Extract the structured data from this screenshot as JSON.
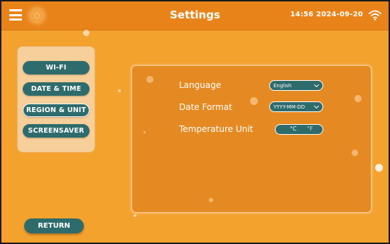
{
  "header": {
    "title": "Settings",
    "time": "14:56",
    "date": "2024-09-20",
    "left_icons": [
      "menu-icon",
      "sun-icon"
    ],
    "right_icon": "wifi-icon"
  },
  "sidebar": {
    "items": [
      {
        "label": "WI-FI",
        "active": false
      },
      {
        "label": "DATE & TIME",
        "active": false
      },
      {
        "label": "REGION & UNIT",
        "active": true
      },
      {
        "label": "SCREENSAVER",
        "active": false
      }
    ]
  },
  "settings": {
    "language": {
      "label": "Language",
      "value": "English"
    },
    "date_format": {
      "label": "Date Format",
      "value": "YYYY-MM-DD"
    },
    "temperature_unit": {
      "label": "Temperature Unit",
      "options": [
        "°C",
        "°F"
      ],
      "selected": "°C"
    }
  },
  "footer": {
    "return_label": "RETURN"
  },
  "colors": {
    "background": "#f4a22e",
    "topbar": "#e8831a",
    "panel": "#e58a22",
    "sidebar_panel": "#f7cf9a",
    "button": "#2e6b6c",
    "text": "#ffffff"
  }
}
